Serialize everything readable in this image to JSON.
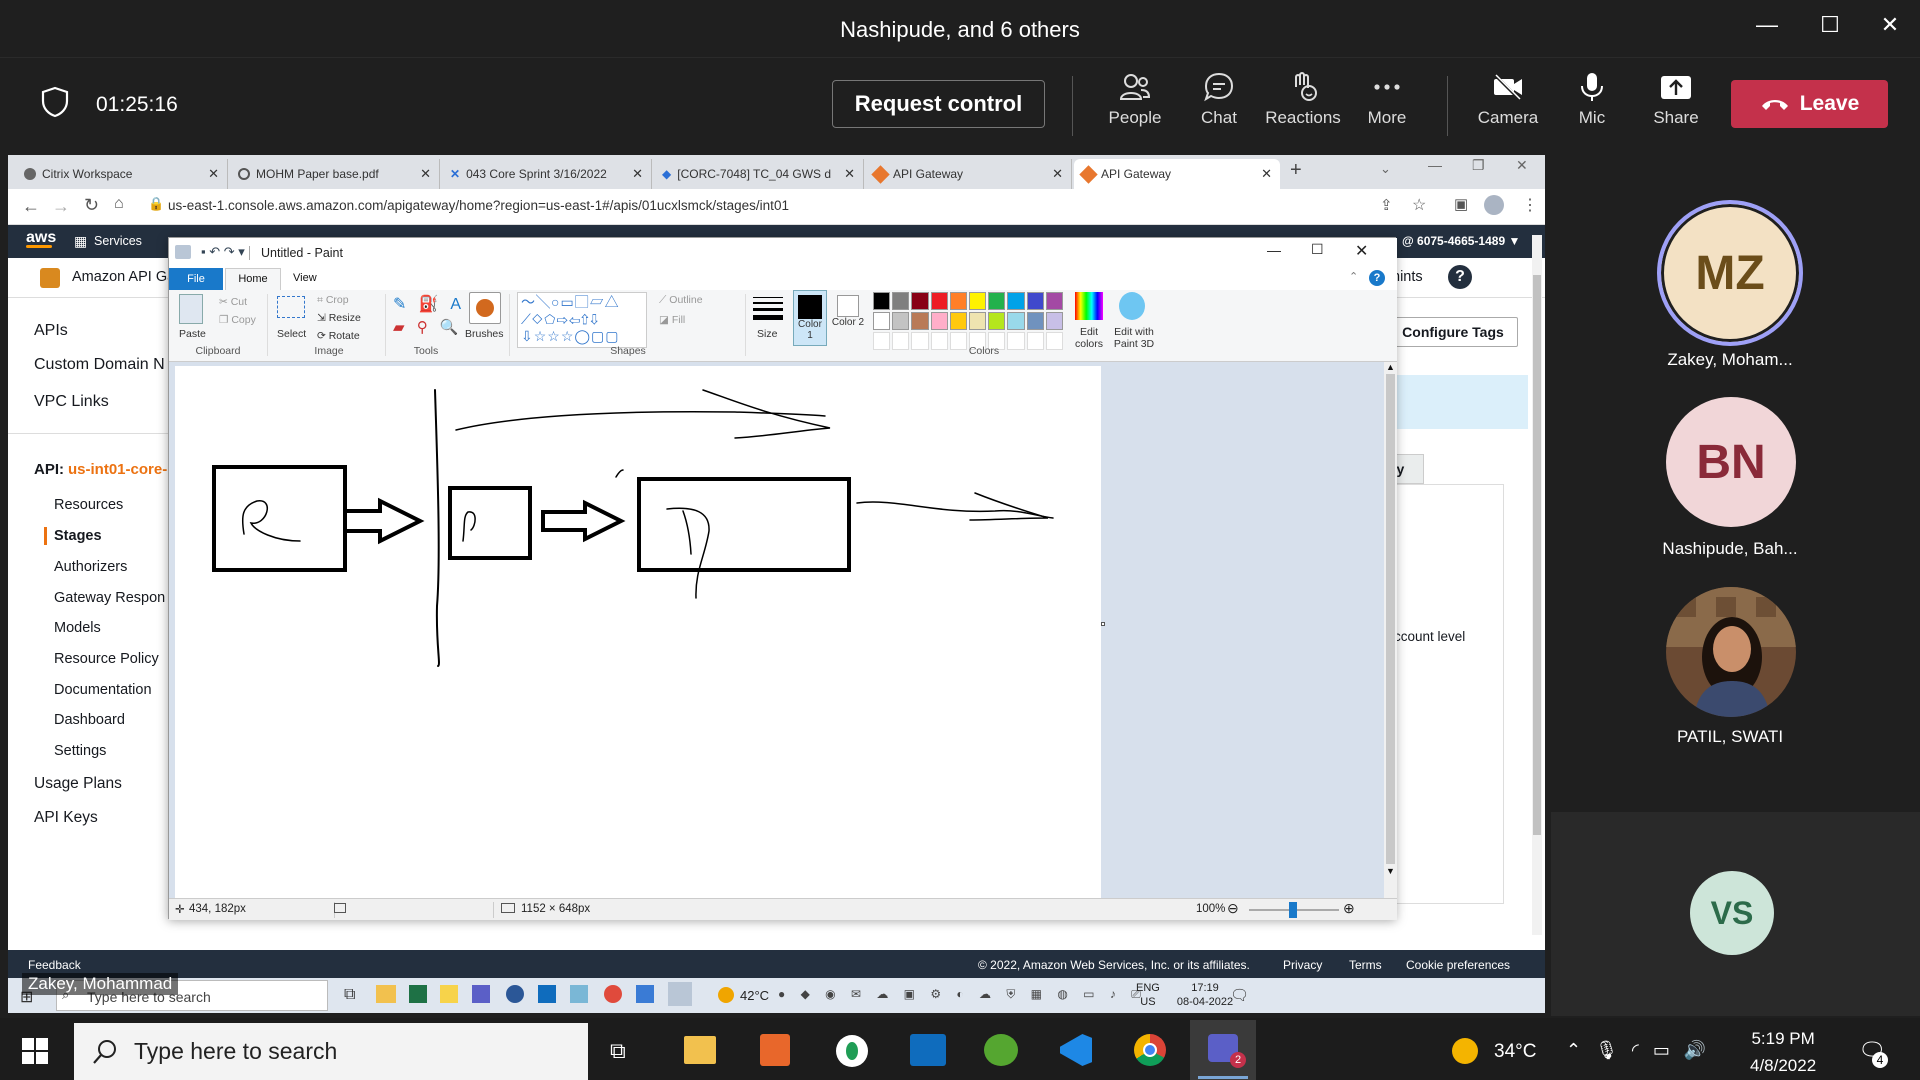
{
  "teams": {
    "meeting_title": "Nashipude, and 6 others",
    "timer": "01:25:16",
    "request_control": "Request control",
    "toolbar": [
      {
        "label": "People",
        "icon": "people-icon"
      },
      {
        "label": "Chat",
        "icon": "chat-icon"
      },
      {
        "label": "Reactions",
        "icon": "reactions-icon"
      },
      {
        "label": "More",
        "icon": "more-icon"
      },
      {
        "label": "Camera",
        "icon": "camera-off-icon"
      },
      {
        "label": "Mic",
        "icon": "mic-icon"
      },
      {
        "label": "Share",
        "icon": "share-icon"
      }
    ],
    "leave": "Leave",
    "participants": [
      {
        "initials": "MZ",
        "name": "Zakey, Moham..."
      },
      {
        "initials": "BN",
        "name": "Nashipude, Bah..."
      },
      {
        "initials": "",
        "name": "PATIL, SWATI"
      },
      {
        "initials": "VS",
        "name": ""
      }
    ],
    "presenter_label": "Zakey, Mohammad"
  },
  "browser": {
    "tabs": [
      {
        "title": "Citrix Workspace",
        "icon": "citrix-icon"
      },
      {
        "title": "MOHM Paper base.pdf",
        "icon": "globe-icon"
      },
      {
        "title": "043 Core Sprint 3/16/2022",
        "icon": "jira-icon"
      },
      {
        "title": "[CORC-7048] TC_04 GWS d",
        "icon": "jira-diamond-icon"
      },
      {
        "title": "API Gateway",
        "icon": "aws-api-icon"
      },
      {
        "title": "API Gateway",
        "icon": "aws-api-icon"
      }
    ],
    "url": "us-east-1.console.aws.amazon.com/apigateway/home?region=us-east-1#/apis/01ucxlsmck/stages/int01"
  },
  "aws": {
    "logo": "aws",
    "services": "Services",
    "account": "@ 6075-4665-1489 ▼",
    "product": "Amazon API Ga",
    "hints": "hints",
    "configure_tags": "Configure Tags",
    "tab_partial": "ry",
    "account_level": "ccount level",
    "nav": [
      "APIs",
      "Custom Domain N",
      "VPC Links"
    ],
    "api_label": "API:",
    "api_name": "us-int01-core-",
    "sub_nav": [
      "Resources",
      "Stages",
      "Authorizers",
      "Gateway Respon",
      "Models",
      "Resource Policy",
      "Documentation",
      "Dashboard",
      "Settings"
    ],
    "bottom_nav": [
      "Usage Plans",
      "API Keys"
    ],
    "footer_feedback": "Feedback",
    "footer_copy": "© 2022, Amazon Web Services, Inc. or its affiliates.",
    "footer_links": [
      "Privacy",
      "Terms",
      "Cookie preferences"
    ]
  },
  "paint": {
    "title": "Untitled - Paint",
    "menu": [
      "File",
      "Home",
      "View"
    ],
    "clipboard": {
      "paste": "Paste",
      "cut": "Cut",
      "copy": "Copy",
      "group": "Clipboard"
    },
    "image": {
      "select": "Select",
      "crop": "Crop",
      "resize": "Resize",
      "rotate": "Rotate",
      "group": "Image"
    },
    "tools_group": "Tools",
    "brushes": "Brushes",
    "shapes": {
      "outline": "Outline",
      "fill": "Fill",
      "group": "Shapes"
    },
    "size": "Size",
    "color1": "Color 1",
    "color2": "Color 2",
    "colors_group": "Colors",
    "edit_colors": "Edit colors",
    "paint3d": "Edit with Paint 3D",
    "palette_row1": [
      "#000000",
      "#7f7f7f",
      "#880015",
      "#ed1c24",
      "#ff7f27",
      "#fff200",
      "#22b14c",
      "#00a2e8",
      "#3f48cc",
      "#a349a4"
    ],
    "palette_row2": [
      "#ffffff",
      "#c3c3c3",
      "#b97a57",
      "#ffaec9",
      "#ffc90e",
      "#efe4b0",
      "#b5e61d",
      "#99d9ea",
      "#7092be",
      "#c8bfe7"
    ],
    "status_pos": "434, 182px",
    "status_size": "1152 × 648px",
    "zoom": "100%"
  },
  "inner_taskbar": {
    "search": "Type here to search",
    "weather": "42°C",
    "lang": "ENG",
    "region": "US",
    "time": "17:19",
    "date": "08-04-2022"
  },
  "taskbar": {
    "search": "Type here to search",
    "weather": "34°C",
    "time": "5:19 PM",
    "date": "4/8/2022",
    "notifications": "4"
  }
}
